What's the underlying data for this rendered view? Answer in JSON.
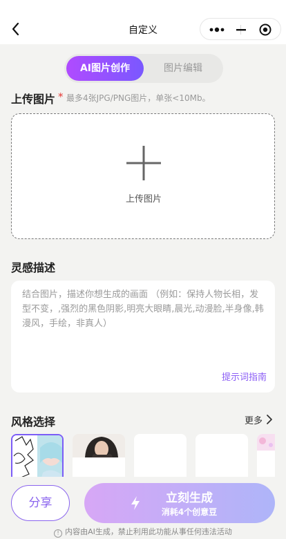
{
  "nav": {
    "title": "自定义"
  },
  "tabs": [
    {
      "label": "AI图片创作",
      "active": true
    },
    {
      "label": "图片编辑",
      "active": false
    }
  ],
  "upload": {
    "title": "上传图片",
    "required_mark": "*",
    "hint": "最多4张JPG/PNG图片，单张<10Mb。",
    "box_label": "上传图片"
  },
  "inspiration": {
    "title": "灵感描述",
    "placeholder": "结合图片，描述你想生成的画面 （例如：保持人物长相，发型不变，,强烈的黑色阴影,明亮大眼睛,晨光,动漫脸,半身像,韩漫风，手绘，非真人）",
    "guide_link": "提示词指南"
  },
  "style": {
    "title": "风格选择",
    "more": "更多"
  },
  "actions": {
    "share": "分享",
    "generate": "立刻生成",
    "cost": "消耗4个创意豆"
  },
  "disclaimer": "内容由AI生成，禁止利用此功能从事任何违法活动",
  "colors": {
    "accent": "#8a64ee",
    "gradient_start": "#b04bff",
    "gradient_end": "#7a58ff",
    "required": "#e53935"
  },
  "icons": {
    "back": "chevron-left-icon",
    "more": "more-dots-icon",
    "minimize": "minus-icon",
    "close": "target-close-icon",
    "plus": "plus-icon",
    "bolt": "lightning-icon",
    "info": "info-icon"
  }
}
